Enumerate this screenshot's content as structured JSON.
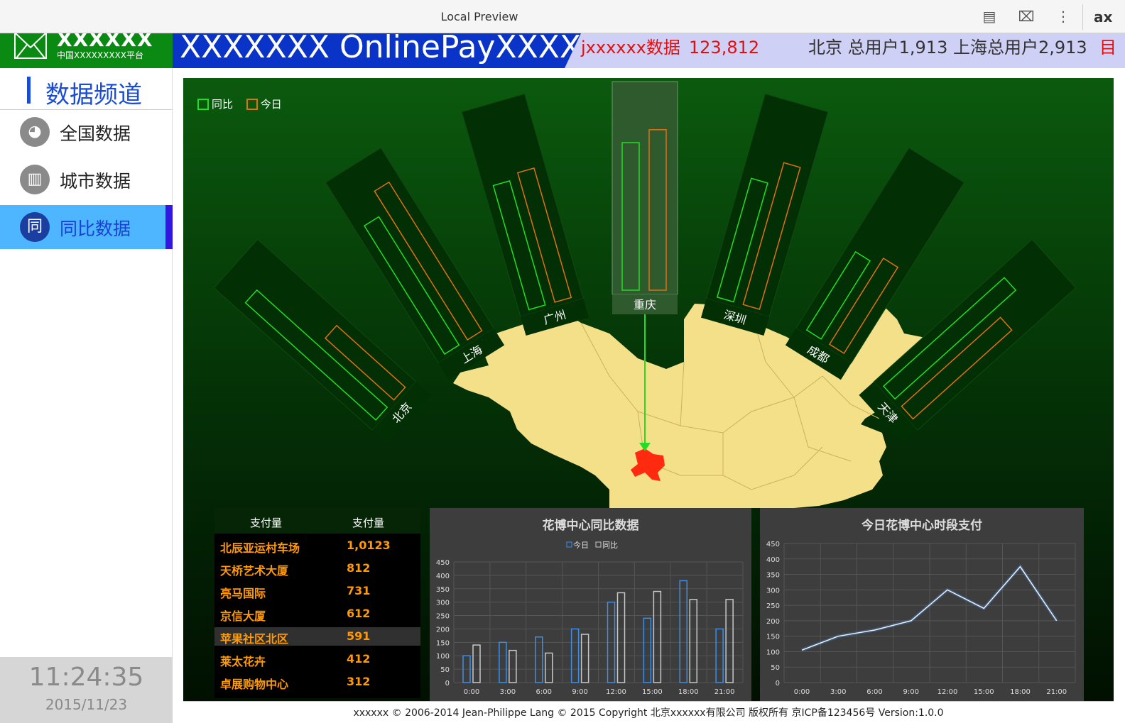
{
  "window": {
    "title": "Local Preview",
    "brand_partial": "ax"
  },
  "logo": {
    "name": "XXXXXX",
    "sub": "中国XXXXXXXXX平台"
  },
  "banner": {
    "title": "XXXXXXX OnlinePayXXXX",
    "ticker_label": "jxxxxxx数据",
    "ticker_value": "123,812",
    "ticker_cities": "北京 总用户1,913  上海总用户2,913",
    "ticker_cut": "目"
  },
  "sidebar": {
    "heading": "数据频道",
    "items": [
      {
        "label": "全国数据",
        "icon": "globe-icon",
        "glyph": "◕"
      },
      {
        "label": "城市数据",
        "icon": "building-icon",
        "glyph": "▥"
      },
      {
        "label": "同比数据",
        "icon": "compare-icon",
        "glyph": "同"
      }
    ],
    "clock_time": "11:24:35",
    "clock_date": "2015/11/23"
  },
  "colors": {
    "yoy": "#22dd22",
    "today": "#e07010",
    "map": "#f5e08a",
    "highlight": "#ff2a10"
  },
  "legend": {
    "yoy": "同比",
    "today": "今日"
  },
  "fan_chart": {
    "type": "bar",
    "categories": [
      "北京",
      "上海",
      "广州",
      "重庆",
      "深圳",
      "成都",
      "天津"
    ],
    "selected": "重庆",
    "series": [
      {
        "name": "同比",
        "values": [
          0.95,
          0.82,
          0.7,
          0.8,
          0.67,
          0.5,
          0.88
        ]
      },
      {
        "name": "今日",
        "values": [
          0.5,
          0.95,
          0.73,
          0.87,
          0.8,
          0.55,
          0.72
        ]
      }
    ]
  },
  "table": {
    "headers": [
      "支付量",
      "支付量"
    ],
    "rows": [
      {
        "name": "北辰亚运村车场",
        "value": "1,0123"
      },
      {
        "name": "天桥艺术大厦",
        "value": "812"
      },
      {
        "name": "亮马国际",
        "value": "731"
      },
      {
        "name": "京信大厦",
        "value": "612"
      },
      {
        "name": "苹果社区北区",
        "value": "591"
      },
      {
        "name": "莱太花卉",
        "value": "412"
      },
      {
        "name": "卓展购物中心",
        "value": "312"
      }
    ],
    "highlight_row": 4
  },
  "chart_data": [
    {
      "type": "bar",
      "title": "花博中心同比数据",
      "categories": [
        "0:00",
        "3:00",
        "6:00",
        "9:00",
        "12:00",
        "15:00",
        "18:00",
        "21:00"
      ],
      "series": [
        {
          "name": "今日",
          "values": [
            100,
            150,
            170,
            200,
            300,
            240,
            380,
            200
          ]
        },
        {
          "name": "同比",
          "values": [
            140,
            120,
            110,
            180,
            335,
            340,
            310,
            310
          ]
        }
      ],
      "ylim": [
        0,
        450
      ],
      "yticks": [
        0,
        50,
        100,
        150,
        200,
        250,
        300,
        350,
        400,
        450
      ],
      "grid": true,
      "legend": "top-center"
    },
    {
      "type": "line",
      "title": "今日花博中心时段支付",
      "categories": [
        "0:00",
        "3:00",
        "6:00",
        "9:00",
        "12:00",
        "15:00",
        "18:00",
        "21:00"
      ],
      "series": [
        {
          "values": [
            105,
            150,
            170,
            200,
            300,
            240,
            375,
            200
          ]
        }
      ],
      "ylim": [
        0,
        450
      ],
      "yticks": [
        0,
        50,
        100,
        150,
        200,
        250,
        300,
        350,
        400,
        450
      ],
      "grid": true
    }
  ],
  "footer": "xxxxxx © 2006-2014 Jean-Philippe Lang © 2015 Copyright 北京xxxxxx有限公司 版权所有 京ICP备123456号 Version:1.0.0"
}
